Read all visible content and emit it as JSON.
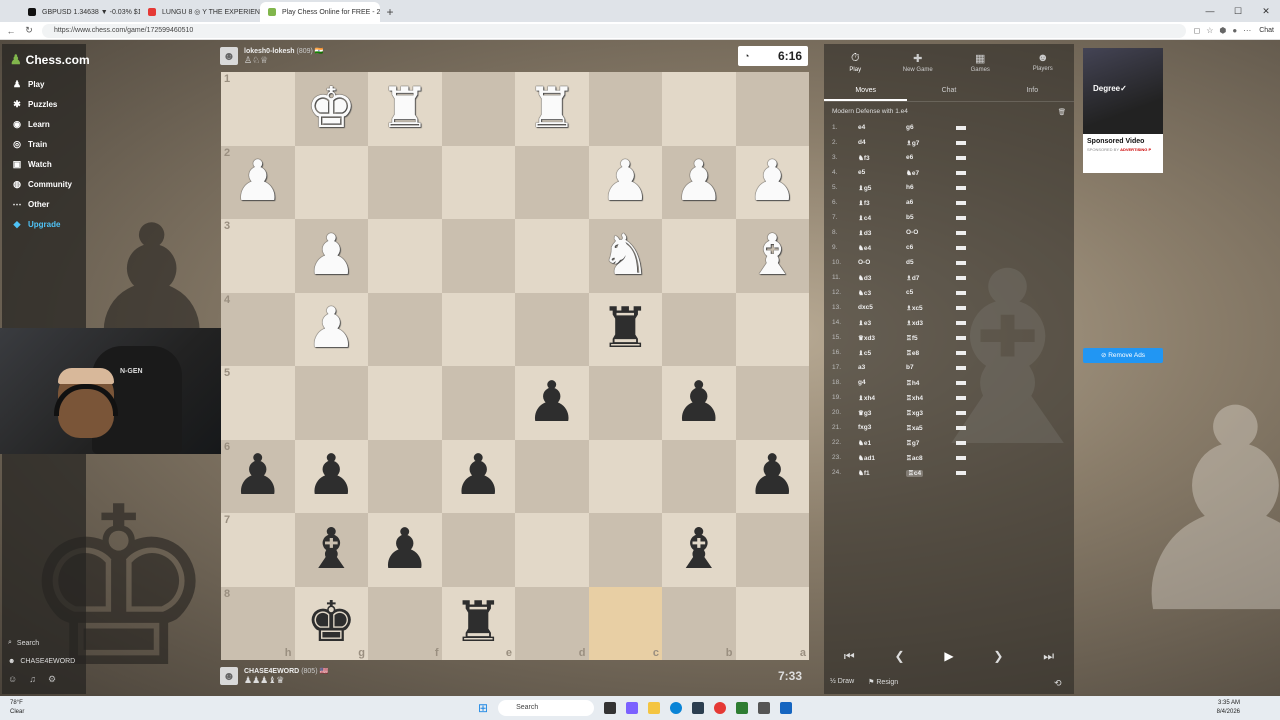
{
  "browser": {
    "tabs": [
      {
        "label": "GBPUSD 1.34638 ▼ -0.03% $100/...",
        "color": "#111"
      },
      {
        "label": "LUNGU 8 ◎ Y THE EXPERIENCE",
        "color": "#e53935"
      },
      {
        "label": "Play Chess Online for FREE - 2 Pla...",
        "color": "#81b64c",
        "active": true
      }
    ],
    "url": "https://www.chess.com/game/172599460510",
    "chat_label": "Chat"
  },
  "sidebar": {
    "logo": "Chess.com",
    "items": [
      {
        "label": "Play",
        "icon": "play-icon",
        "glyph": "♟"
      },
      {
        "label": "Puzzles",
        "icon": "puzzles-icon",
        "glyph": "✱"
      },
      {
        "label": "Learn",
        "icon": "learn-icon",
        "glyph": "◉"
      },
      {
        "label": "Train",
        "icon": "train-icon",
        "glyph": "◎"
      },
      {
        "label": "Watch",
        "icon": "watch-icon",
        "glyph": "▣"
      },
      {
        "label": "Community",
        "icon": "community-icon",
        "glyph": "◍"
      },
      {
        "label": "Other",
        "icon": "other-icon",
        "glyph": "⋯"
      },
      {
        "label": "Upgrade",
        "icon": "diamond-icon",
        "glyph": "◆"
      }
    ],
    "search": "Search",
    "username": "CHASE4EWORD"
  },
  "webcam": {
    "brand": "N-GEN"
  },
  "top_player": {
    "name": "lokesh0-lokesh",
    "rating": "(809)",
    "flag": "🇮🇳",
    "clock": "6:16"
  },
  "bottom_player": {
    "name": "CHASE4EWORD",
    "rating": "(805)",
    "flag": "🇺🇸",
    "clock": "7:33"
  },
  "board": {
    "ranks": [
      "1",
      "2",
      "3",
      "4",
      "5",
      "6",
      "7",
      "8"
    ],
    "files": [
      "h",
      "g",
      "f",
      "e",
      "d",
      "c",
      "b",
      "a"
    ],
    "rows": [
      [
        "",
        "wK",
        "wR",
        "",
        "wR",
        "",
        "",
        ""
      ],
      [
        "wP",
        "",
        "",
        "",
        "",
        "wP",
        "wP",
        "wP"
      ],
      [
        "",
        "wP",
        "",
        "",
        "",
        "wN",
        "",
        "wB"
      ],
      [
        "",
        "wP",
        "",
        "",
        "",
        "bR",
        "",
        ""
      ],
      [
        "",
        "",
        "",
        "",
        "bP",
        "",
        "bP",
        ""
      ],
      [
        "bP",
        "bP",
        "",
        "bP",
        "",
        "",
        "",
        "bP"
      ],
      [
        "",
        "bB",
        "bP",
        "",
        "",
        "",
        "bB",
        ""
      ],
      [
        "",
        "bK",
        "",
        "bR",
        "",
        "",
        "",
        ""
      ]
    ],
    "highlight": [
      [
        7,
        5
      ]
    ]
  },
  "right_panel": {
    "tabs": [
      {
        "label": "Play",
        "glyph": "⏱",
        "active": true
      },
      {
        "label": "New Game",
        "glyph": "✚"
      },
      {
        "label": "Games",
        "glyph": "▦"
      },
      {
        "label": "Players",
        "glyph": "☻"
      }
    ],
    "subtabs": [
      {
        "label": "Moves",
        "active": true
      },
      {
        "label": "Chat"
      },
      {
        "label": "Info"
      }
    ],
    "opening": "Modern Defense with 1.e4",
    "moves": [
      {
        "n": "1.",
        "w": "e4",
        "b": "g6"
      },
      {
        "n": "2.",
        "w": "d4",
        "b": "♗g7"
      },
      {
        "n": "3.",
        "w": "♞f3",
        "b": "e6"
      },
      {
        "n": "4.",
        "w": "e5",
        "b": "♞e7"
      },
      {
        "n": "5.",
        "w": "♝g5",
        "b": "h6"
      },
      {
        "n": "6.",
        "w": "♝f3",
        "b": "a6"
      },
      {
        "n": "7.",
        "w": "♝c4",
        "b": "b5"
      },
      {
        "n": "8.",
        "w": "♝d3",
        "b": "O-O"
      },
      {
        "n": "9.",
        "w": "♞e4",
        "b": "c6"
      },
      {
        "n": "10.",
        "w": "O-O",
        "b": "d5"
      },
      {
        "n": "11.",
        "w": "♞d3",
        "b": "♗d7"
      },
      {
        "n": "12.",
        "w": "♞c3",
        "b": "c5"
      },
      {
        "n": "13.",
        "w": "dxc5",
        "b": "♗xc5"
      },
      {
        "n": "14.",
        "w": "♝e3",
        "b": "♗xd3"
      },
      {
        "n": "15.",
        "w": "♛xd3",
        "b": "♖f5"
      },
      {
        "n": "16.",
        "w": "♝c5",
        "b": "♖e8"
      },
      {
        "n": "17.",
        "w": "a3",
        "b": "b7"
      },
      {
        "n": "18.",
        "w": "g4",
        "b": "♖h4"
      },
      {
        "n": "19.",
        "w": "♝xh4",
        "b": "♖xh4"
      },
      {
        "n": "20.",
        "w": "♛g3",
        "b": "♖xg3"
      },
      {
        "n": "21.",
        "w": "fxg3",
        "b": "♖xa5"
      },
      {
        "n": "22.",
        "w": "♞e1",
        "b": "♖g7"
      },
      {
        "n": "23.",
        "w": "♞ad1",
        "b": "♖ac8"
      },
      {
        "n": "24.",
        "w": "♞f1",
        "b": "♖c4",
        "current": true
      }
    ],
    "controls": [
      "first-icon",
      "prev-icon",
      "play-icon",
      "next-icon",
      "last-icon"
    ],
    "draw_label": "Draw",
    "resign_label": "Resign"
  },
  "ad": {
    "brand": "Degree✓",
    "title": "Sponsored Video",
    "sponsor_prefix": "SPONSORED BY",
    "sponsor_name": "ADVERTISING P",
    "remove_ads": "Remove Ads"
  },
  "taskbar": {
    "temp": "78°F",
    "weather": "Clear",
    "search": "Search",
    "time": "3:35 AM",
    "date": "8/4/2026"
  }
}
